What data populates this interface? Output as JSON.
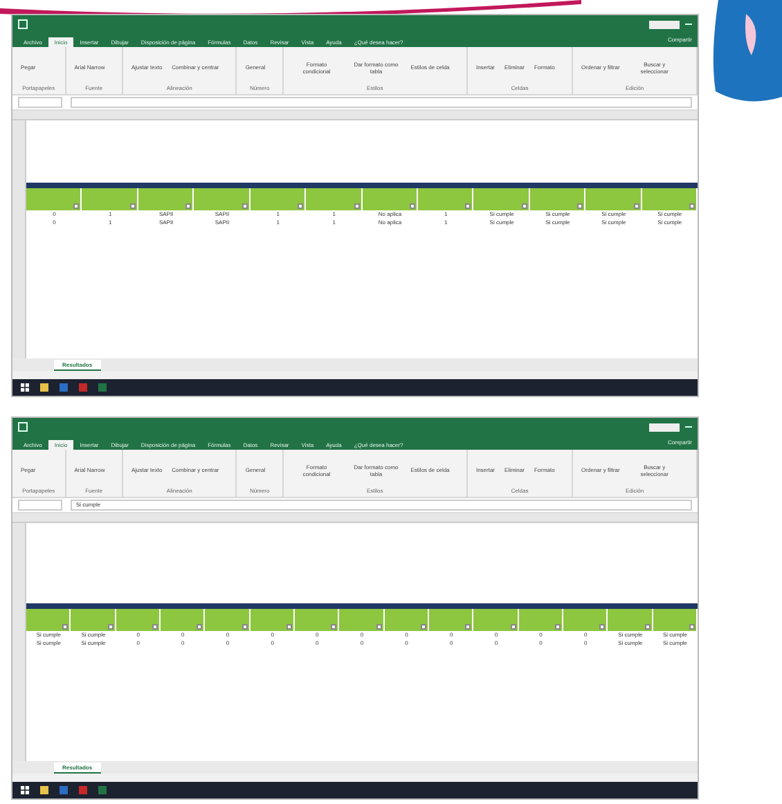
{
  "windows": [
    {
      "tabs": [
        {
          "label": "Archivo",
          "selected": false
        },
        {
          "label": "Inicio",
          "selected": true
        },
        {
          "label": "Insertar",
          "selected": false
        },
        {
          "label": "Dibujar",
          "selected": false
        },
        {
          "label": "Disposición de página",
          "selected": false
        },
        {
          "label": "Fórmulas",
          "selected": false
        },
        {
          "label": "Datos",
          "selected": false
        },
        {
          "label": "Revisar",
          "selected": false
        },
        {
          "label": "Vista",
          "selected": false
        },
        {
          "label": "Ayuda",
          "selected": false
        },
        {
          "label": "¿Qué desea hacer?",
          "selected": false
        }
      ],
      "share": "Compartir",
      "ribbon": [
        {
          "label": "Portapapeles",
          "buttons": [
            "Pegar"
          ]
        },
        {
          "label": "Fuente",
          "buttons": [
            "Arial Narrow"
          ]
        },
        {
          "label": "Alineación",
          "buttons": [
            "Ajustar texto",
            "Combinar y centrar"
          ]
        },
        {
          "label": "Número",
          "buttons": [
            "General"
          ]
        },
        {
          "label": "Estilos",
          "buttons": [
            "Formato condicional",
            "Dar formato como tabla",
            "Estilos de celda"
          ]
        },
        {
          "label": "Celdas",
          "buttons": [
            "Insertar",
            "Eliminar",
            "Formato"
          ]
        },
        {
          "label": "Edición",
          "buttons": [
            "Ordenar y filtrar",
            "Buscar y seleccionar"
          ]
        }
      ],
      "columns": [
        {
          "filter": true
        },
        {
          "filter": true
        },
        {
          "filter": true
        },
        {
          "filter": true
        },
        {
          "filter": true
        },
        {
          "filter": true
        },
        {
          "filter": true
        },
        {
          "filter": true
        },
        {
          "filter": true
        },
        {
          "filter": true
        },
        {
          "filter": true
        },
        {
          "filter": true
        }
      ],
      "rows": [
        [
          "0",
          "1",
          "SAPII",
          "SAPII",
          "1",
          "1",
          "No aplica",
          "1",
          "Si cumple",
          "Si cumple",
          "Si cumple",
          "Si cumple"
        ],
        [
          "0",
          "1",
          "SAPII",
          "SAPII",
          "1",
          "1",
          "No aplica",
          "1",
          "Si cumple",
          "Si cumple",
          "Si cumple",
          "Si cumple"
        ]
      ],
      "sheet_tab": "Resultados"
    },
    {
      "tabs": [
        {
          "label": "Archivo",
          "selected": false
        },
        {
          "label": "Inicio",
          "selected": true
        },
        {
          "label": "Insertar",
          "selected": false
        },
        {
          "label": "Dibujar",
          "selected": false
        },
        {
          "label": "Disposición de página",
          "selected": false
        },
        {
          "label": "Fórmulas",
          "selected": false
        },
        {
          "label": "Datos",
          "selected": false
        },
        {
          "label": "Revisar",
          "selected": false
        },
        {
          "label": "Vista",
          "selected": false
        },
        {
          "label": "Ayuda",
          "selected": false
        },
        {
          "label": "¿Qué desea hacer?",
          "selected": false
        }
      ],
      "share": "Compartir",
      "ribbon": [
        {
          "label": "Portapapeles",
          "buttons": [
            "Pegar"
          ]
        },
        {
          "label": "Fuente",
          "buttons": [
            "Arial Narrow"
          ]
        },
        {
          "label": "Alineación",
          "buttons": [
            "Ajustar texto",
            "Combinar y centrar"
          ]
        },
        {
          "label": "Número",
          "buttons": [
            "General"
          ]
        },
        {
          "label": "Estilos",
          "buttons": [
            "Formato condicional",
            "Dar formato como tabla",
            "Estilos de celda"
          ]
        },
        {
          "label": "Celdas",
          "buttons": [
            "Insertar",
            "Eliminar",
            "Formato"
          ]
        },
        {
          "label": "Edición",
          "buttons": [
            "Ordenar y filtrar",
            "Buscar y seleccionar"
          ]
        }
      ],
      "formula": "Si cumple",
      "columns": [
        {
          "filter": true
        },
        {
          "filter": true
        },
        {
          "filter": true
        },
        {
          "filter": true
        },
        {
          "filter": true
        },
        {
          "filter": true
        },
        {
          "filter": true
        },
        {
          "filter": true
        },
        {
          "filter": true
        },
        {
          "filter": true
        },
        {
          "filter": true
        },
        {
          "filter": true
        },
        {
          "filter": true
        },
        {
          "filter": true
        },
        {
          "filter": true
        }
      ],
      "rows": [
        [
          "Si cumple",
          "Si cumple",
          "0",
          "0",
          "0",
          "0",
          "0",
          "0",
          "0",
          "0",
          "0",
          "0",
          "0",
          "Si cumple",
          "Si cumple"
        ],
        [
          "Si cumple",
          "Si cumple",
          "0",
          "0",
          "0",
          "0",
          "0",
          "0",
          "0",
          "0",
          "0",
          "0",
          "0",
          "Si cumple",
          "Si cumple"
        ]
      ],
      "sheet_tab": "Resultados"
    }
  ]
}
